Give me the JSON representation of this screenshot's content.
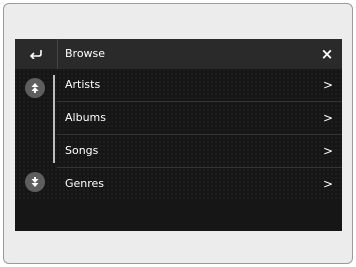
{
  "header": {
    "back_icon": "return-arrow-icon",
    "title": "Browse",
    "close_label": "×",
    "close_icon": "close-icon"
  },
  "scroll": {
    "up_icon": "scroll-up-icon",
    "down_icon": "scroll-down-icon"
  },
  "list": {
    "items": [
      {
        "label": "Artists",
        "chevron": ">"
      },
      {
        "label": "Albums",
        "chevron": ">"
      },
      {
        "label": "Songs",
        "chevron": ">"
      },
      {
        "label": "Genres",
        "chevron": ">"
      }
    ]
  },
  "colors": {
    "background": "#1c1c1c",
    "header": "#2a2a2a",
    "text": "#ffffff",
    "scroll_button": "#5e5e5e"
  }
}
